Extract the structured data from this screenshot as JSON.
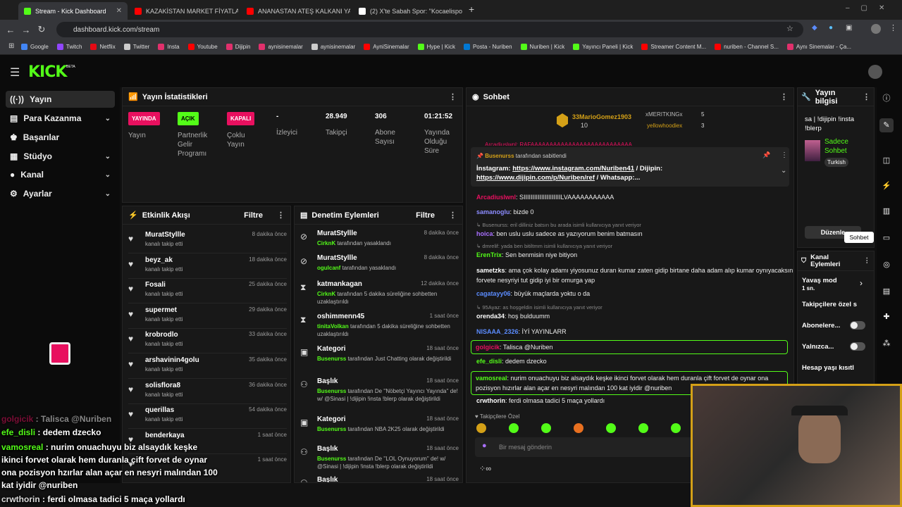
{
  "browser": {
    "tabs": [
      {
        "label": "Stream - Kick Dashboard",
        "color": "#53fc18"
      },
      {
        "label": "KAZAKİSTAN MARKET FİYATLA...",
        "color": "#ff0000"
      },
      {
        "label": "ANANASTAN ATEŞ KALKANI YA...",
        "color": "#ff0000"
      },
      {
        "label": "(2) X'te Sabah Spor: \"Kocaelispo...",
        "color": "#ffffff"
      }
    ],
    "url": "dashboard.kick.com/stream",
    "bookmarks": [
      {
        "label": "Google",
        "color": "#4285f4"
      },
      {
        "label": "Twitch",
        "color": "#9146ff"
      },
      {
        "label": "Netflix",
        "color": "#e50914"
      },
      {
        "label": "Twitter",
        "color": "#cccccc"
      },
      {
        "label": "Insta",
        "color": "#e1306c"
      },
      {
        "label": "Youtube",
        "color": "#ff0000"
      },
      {
        "label": "Dijipin",
        "color": "#e1306c"
      },
      {
        "label": "aynisinemalar",
        "color": "#e1306c"
      },
      {
        "label": "aynisinemalar",
        "color": "#cccccc"
      },
      {
        "label": "AyniSinemalar",
        "color": "#ff0000"
      },
      {
        "label": "Hype | Kick",
        "color": "#53fc18"
      },
      {
        "label": "Posta - Nuriben",
        "color": "#0078d4"
      },
      {
        "label": "Nuriben | Kick",
        "color": "#53fc18"
      },
      {
        "label": "Yayıncı Paneli | Kick",
        "color": "#53fc18"
      },
      {
        "label": "Streamer Content M...",
        "color": "#ff0000"
      },
      {
        "label": "nuriben - Channel S...",
        "color": "#ff0000"
      },
      {
        "label": "Aynı Sinemalar - Ça...",
        "color": "#e1306c"
      }
    ]
  },
  "kick": {
    "logo": "KICK",
    "beta": "BETA"
  },
  "sidebar": {
    "items": [
      {
        "label": "Yayın",
        "icon": "broadcast-icon"
      },
      {
        "label": "Para Kazanma",
        "icon": "money-icon"
      },
      {
        "label": "Başarılar",
        "icon": "trophy-icon"
      },
      {
        "label": "Stüdyo",
        "icon": "studio-icon"
      },
      {
        "label": "Kanal",
        "icon": "user-icon"
      },
      {
        "label": "Ayarlar",
        "icon": "gear-icon"
      }
    ]
  },
  "stats": {
    "title": "Yayın İstatistikleri",
    "items": [
      {
        "value": "YAYINDA",
        "label": "Yayın",
        "badge": "#e8105f"
      },
      {
        "value": "AÇIK",
        "label": "Partnerlik Gelir Programı",
        "badge": "#53fc18"
      },
      {
        "value": "KAPALI",
        "label": "Çoklu Yayın",
        "badge": "#e8105f"
      },
      {
        "value": "-",
        "label": "İzleyici"
      },
      {
        "value": "28.949",
        "label": "Takipçi"
      },
      {
        "value": "306",
        "label": "Abone Sayısı"
      },
      {
        "value": "01:21:52",
        "label": "Yayında Olduğu Süre"
      }
    ]
  },
  "activity": {
    "title": "Etkinlik Akışı",
    "filter": "Filtre",
    "events": [
      {
        "name": "MuratStyllle",
        "sub": "kanalı takip etti",
        "time": "8 dakika önce"
      },
      {
        "name": "beyz_ak",
        "sub": "kanalı takip etti",
        "time": "18 dakika önce"
      },
      {
        "name": "Fosali",
        "sub": "kanalı takip etti",
        "time": "25 dakika önce"
      },
      {
        "name": "supermet",
        "sub": "kanalı takip etti",
        "time": "29 dakika önce"
      },
      {
        "name": "krobrodlo",
        "sub": "kanalı takip etti",
        "time": "33 dakika önce"
      },
      {
        "name": "arshavinin4golu",
        "sub": "kanalı takip etti",
        "time": "35 dakika önce"
      },
      {
        "name": "solisflora8",
        "sub": "kanalı takip etti",
        "time": "36 dakika önce"
      },
      {
        "name": "querillas",
        "sub": "kanalı takip etti",
        "time": "54 dakika önce"
      },
      {
        "name": "benderkaya",
        "sub": "",
        "time": "1 saat önce"
      },
      {
        "name": "",
        "sub": "",
        "time": "1 saat önce"
      }
    ]
  },
  "moderation": {
    "title": "Denetim Eylemleri",
    "filter": "Filtre",
    "items": [
      {
        "name": "MuratStyllle",
        "actor": "CirknK",
        "rest": " tarafından yasaklandı",
        "time": "8 dakika önce",
        "icon": "ban-icon"
      },
      {
        "name": "MuratStyllle",
        "actor": "ogulcanf",
        "rest": " tarafından yasaklandı",
        "time": "8 dakika önce",
        "icon": "ban-icon"
      },
      {
        "name": "katmankagan",
        "actor": "CirknK",
        "rest": " tarafından 5 dakika süreliğine sohbetten uzaklaştırıldı",
        "time": "12 dakika önce",
        "icon": "hourglass-icon"
      },
      {
        "name": "oshimmenn45",
        "actor": "tinitaVolkan",
        "rest": " tarafından 5 dakika süreliğine sohbetten uzaklaştırıldı",
        "time": "1 saat önce",
        "icon": "hourglass-icon"
      },
      {
        "name": "Kategori",
        "actor": "Busenurss",
        "rest": " tarafından Just Chatting olarak değiştirildi",
        "time": "18 saat önce",
        "icon": "category-icon"
      },
      {
        "name": "Başlık",
        "actor": "Busenurss",
        "rest": " tarafından De ''Nöbetçi Yayıncı Yayında'' de! w/ @Sinasi | !dijipin !insta !blerp olarak değiştirildi",
        "time": "18 saat önce",
        "icon": "title-icon"
      },
      {
        "name": "Kategori",
        "actor": "Busenurss",
        "rest": " tarafından NBA 2K25 olarak değiştirildi",
        "time": "18 saat önce",
        "icon": "category-icon"
      },
      {
        "name": "Başlık",
        "actor": "Busenurss",
        "rest": " tarafından De ''LOL Oynuyorum'' de! w/ @Sinasi | !dijipin !insta !blerp olarak değiştirildi",
        "time": "18 saat önce",
        "icon": "title-icon"
      },
      {
        "name": "Başlık",
        "actor": "",
        "rest": "",
        "time": "18 saat önce",
        "icon": "title-icon"
      }
    ]
  },
  "chat": {
    "title": "Sohbet",
    "leaderboard": [
      {
        "name": "33MarioGomez1903",
        "count": "10"
      },
      {
        "name": "xMERITKINGx",
        "count": "5"
      },
      {
        "name": "yellowhoodiex",
        "count": "3"
      }
    ],
    "cut_text": "Arcadiuslwnl: RAFAAAAAAAAAAAAAAAAAAAAAAAAAAA",
    "pinned": {
      "by": "Busenurss",
      "by_suffix": "tarafından sabitlendi",
      "text_label": "İnstagram:",
      "link1": "https://www.instagram.com/Nuriben41",
      "mid": " / Dijipin: ",
      "link2": "https://www.dijipin.com/p/Nuriben/ref",
      "tail": " / Whatsapp:..."
    },
    "messages": [
      {
        "user": "Arcadiuslwnl",
        "color": "#e8105f",
        "text": "SIIIIIIIIIIIIIIIIIIIIILVAAAAAAAAAAA"
      },
      {
        "user": "samanoglu",
        "color": "#8c8cff",
        "text": "bizde 0"
      },
      {
        "reply": "Busenurss: eril dilliniz batsın bu arada isimli kullanıcıya yanıt veriyor"
      },
      {
        "user": "hoica",
        "color": "#a970ff",
        "text": "ben uslu uslu sadece as yazıyorum benim batmasın"
      },
      {
        "reply": "dmrelif: yada ben bitiltmm isimli kullanıcıya yanıt veriyor"
      },
      {
        "user": "ErenTrix",
        "color": "#53fc18",
        "text": "Sen benmisin niye bitiyon"
      },
      {
        "user": "sametzks",
        "color": "#ffffff",
        "text": "ama çok kolay adamı yiyosunuz duran kumar zaten gidip birtane daha adam alıp kumar oynıyacaksın forvete nesyriyi tut gidip iyi bir omurga yap"
      },
      {
        "user": "cagatayy06",
        "color": "#5b8cff",
        "text": "büyük maçlarda yoktu o da"
      },
      {
        "reply": "95Ayaz: as hoşgeldin isimli kullanıcıya yanıt veriyor"
      },
      {
        "user": "orenda34",
        "color": "#ffffff",
        "text": "hoş bulduumm"
      },
      {
        "user": "NISAAA_2326",
        "color": "#5b8cff",
        "text": "İYİ YAYINLARR"
      },
      {
        "user": "golgicik",
        "color": "#e8105f",
        "text": "Talisca @Nuriben"
      },
      {
        "user": "efe_disli",
        "color": "#53fc18",
        "text": "dedem dzecko"
      },
      {
        "user": "vamosreal",
        "color": "#53fc18",
        "text": "nurim onuachuyu biz alsaydık keşke ikinci forvet olarak hem duranla çift forvet de oynar ona pozisyon hızırlar alan açar en nesyri malından 100 kat iyidir @nuriben"
      },
      {
        "user": "crwthorin",
        "color": "#ffffff",
        "text": "ferdi olmasa tadici 5 maça yollardı"
      }
    ],
    "followers_only": "Takipçilere Özel",
    "placeholder": "Bir mesaj gönderin"
  },
  "info": {
    "title": "Yayın bilgisi",
    "stream_title": "sa | !dijipin !insta !blerp",
    "category": "Sadece Sohbet",
    "language": "Turkish",
    "edit": "Düzenle",
    "tooltip": "Sohbet"
  },
  "channel_actions": {
    "title": "Kanal Eylemleri",
    "slow_mode": "Yavaş mod",
    "slow_value": "1 sn.",
    "followers_only": "Takipçilere özel s",
    "subs": "Abonelere...",
    "only": "Yalnızca...",
    "age": "Hesap yaşı kısıtl"
  },
  "overlay": {
    "lines": [
      {
        "user": "golgicik",
        "text": "Talisca @Nuriben"
      },
      {
        "user": "efe_disli",
        "text": "dedem dzecko"
      },
      {
        "user": "vamosreal",
        "text": "nurim onuachuyu biz alsaydık keşke ikinci forvet olarak hem duranla çift forvet de oynar ona pozisyon hzırlar alan açar en nesyri malından 100 kat iyidir @nuriben"
      },
      {
        "user": "crwthorin",
        "text": "ferdi olmasa tadici 5 maça yollardı"
      }
    ]
  }
}
